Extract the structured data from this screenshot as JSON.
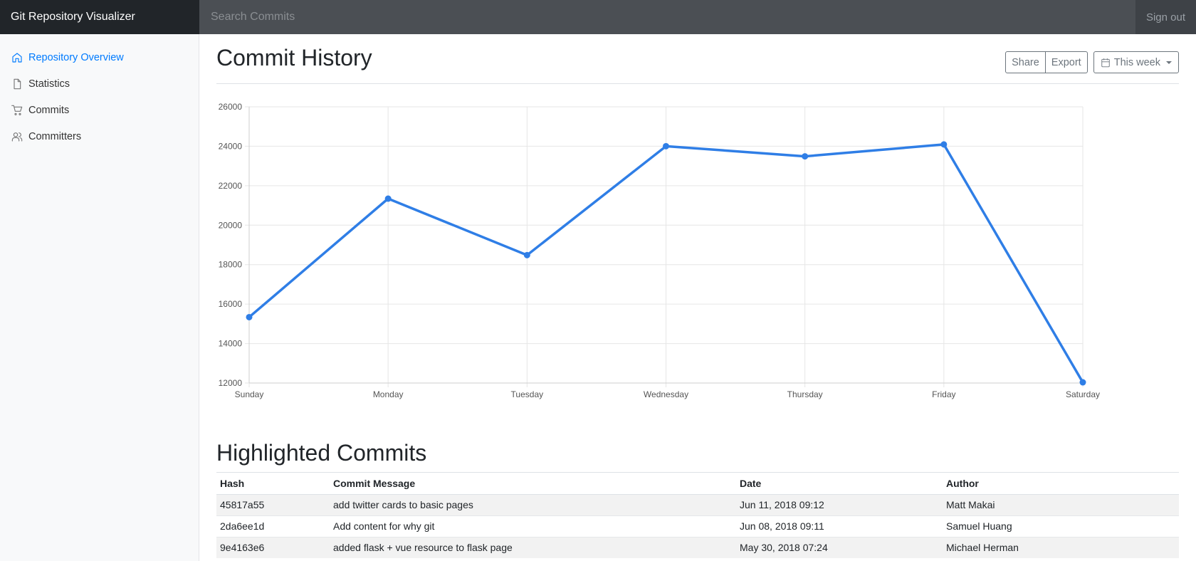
{
  "navbar": {
    "brand": "Git Repository Visualizer",
    "search_placeholder": "Search Commits",
    "signout_label": "Sign out"
  },
  "sidebar": {
    "items": [
      {
        "label": "Repository Overview",
        "icon": "home-icon",
        "active": true
      },
      {
        "label": "Statistics",
        "icon": "file-icon",
        "active": false
      },
      {
        "label": "Commits",
        "icon": "cart-icon",
        "active": false
      },
      {
        "label": "Committers",
        "icon": "users-icon",
        "active": false
      }
    ]
  },
  "header": {
    "title": "Commit History",
    "share_label": "Share",
    "export_label": "Export",
    "range_label": "This week"
  },
  "colors": {
    "accent": "#007bff",
    "line": "#2f7ee6",
    "navbar": "#343a40"
  },
  "chart_data": {
    "type": "line",
    "categories": [
      "Sunday",
      "Monday",
      "Tuesday",
      "Wednesday",
      "Thursday",
      "Friday",
      "Saturday"
    ],
    "values": [
      15339,
      21345,
      18483,
      24003,
      23489,
      24092,
      12034
    ],
    "ylim": [
      12000,
      26000
    ],
    "yticks": [
      12000,
      14000,
      16000,
      18000,
      20000,
      22000,
      24000,
      26000
    ],
    "grid": true
  },
  "highlighted": {
    "title": "Highlighted Commits",
    "columns": [
      "Hash",
      "Commit Message",
      "Date",
      "Author"
    ],
    "rows": [
      [
        "45817a55",
        "add twitter cards to basic pages",
        "Jun 11, 2018 09:12",
        "Matt Makai"
      ],
      [
        "2da6ee1d",
        "Add content for why git",
        "Jun 08, 2018 09:11",
        "Samuel Huang"
      ],
      [
        "9e4163e6",
        "added flask + vue resource to flask page",
        "May 30, 2018 07:24",
        "Michael Herman"
      ]
    ]
  }
}
